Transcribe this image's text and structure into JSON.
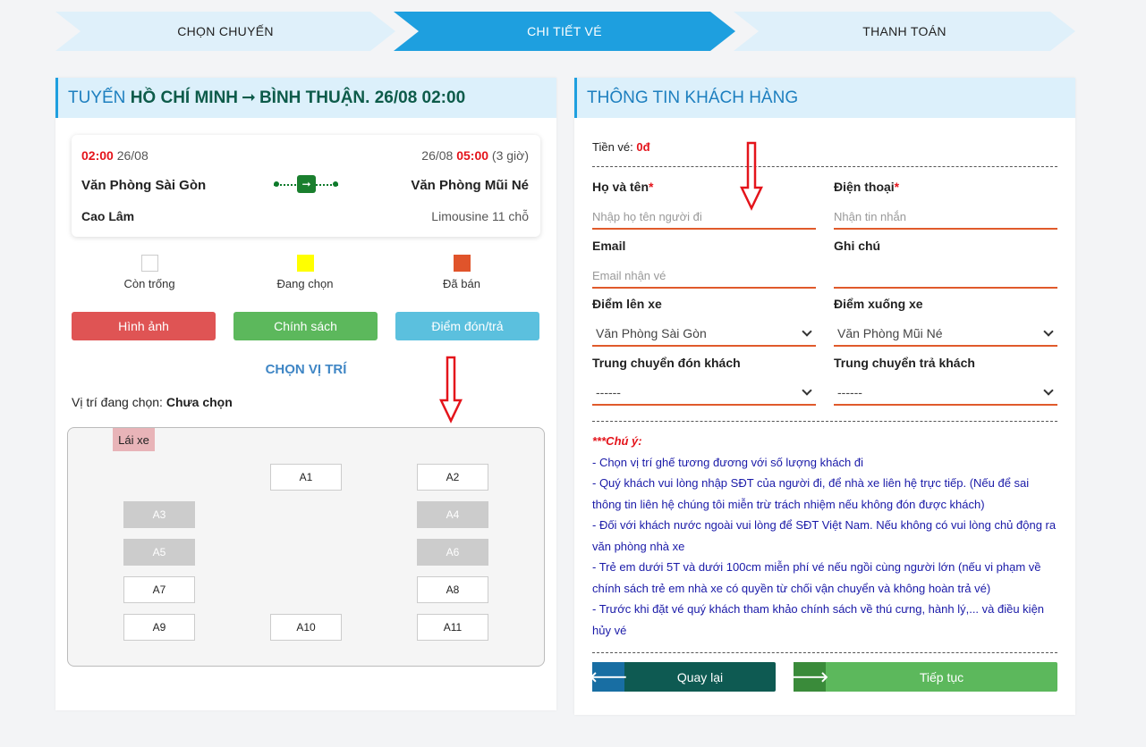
{
  "steps": [
    "CHỌN CHUYẾN",
    "CHI TIẾT VÉ",
    "THANH TOÁN"
  ],
  "route": {
    "prefix": "TUYẾN",
    "from": "HỒ CHÍ MINH",
    "arrow": "➞",
    "to": "BÌNH THUẬN",
    "datetime": ". 26/08 02:00"
  },
  "trip": {
    "depart_time": "02:00",
    "depart_date": "26/08",
    "arrive_date": "26/08",
    "arrive_time": "05:00",
    "duration": "(3 giờ)",
    "from_office": "Văn Phòng Sài Gòn",
    "to_office": "Văn Phòng Mũi Né",
    "operator": "Cao Lâm",
    "vehicle": "Limousine 11 chỗ"
  },
  "legend": [
    {
      "label": "Còn trống",
      "color": "#ffffff"
    },
    {
      "label": "Đang chọn",
      "color": "#ffff00"
    },
    {
      "label": "Đã bán",
      "color": "#e0542b"
    }
  ],
  "buttons": {
    "images": "Hình ảnh",
    "policy": "Chính sách",
    "points": "Điểm đón/trả"
  },
  "choose_title": "CHỌN VỊ TRÍ",
  "current_pos": {
    "label": "Vị trí đang chọn: ",
    "value": "Chưa chọn"
  },
  "driver": "Lái xe",
  "seats": [
    {
      "label": "A1",
      "sold": false
    },
    {
      "label": "A2",
      "sold": false
    },
    {
      "label": "A3",
      "sold": true
    },
    {
      "label": "A4",
      "sold": true
    },
    {
      "label": "A5",
      "sold": true
    },
    {
      "label": "A6",
      "sold": true
    },
    {
      "label": "A7",
      "sold": false
    },
    {
      "label": "A8",
      "sold": false
    },
    {
      "label": "A9",
      "sold": false
    },
    {
      "label": "A10",
      "sold": false
    },
    {
      "label": "A11",
      "sold": false
    }
  ],
  "customer": {
    "title": "THÔNG TIN KHÁCH HÀNG",
    "price_label": "Tiền vé: ",
    "price_value": "0đ",
    "name_label": "Họ và tên",
    "name_placeholder": "Nhập họ tên người đi",
    "phone_label": "Điện thoại",
    "phone_placeholder": "Nhận tin nhắn",
    "email_label": "Email",
    "email_placeholder": "Email nhận vé",
    "note_label": "Ghi chú",
    "note_placeholder": "",
    "pickup_label": "Điểm lên xe",
    "pickup_value": "Văn Phòng Sài Gòn",
    "dropoff_label": "Điểm xuống xe",
    "dropoff_value": "Văn Phòng Mũi Né",
    "transfer_pick_label": "Trung chuyển đón khách",
    "transfer_pick_value": "------",
    "transfer_drop_label": "Trung chuyển trả khách",
    "transfer_drop_value": "------",
    "required_mark": "*"
  },
  "notes": {
    "title": "***Chú ý:",
    "lines": [
      "- Chọn vị trí ghế tương đương với số lượng khách đi",
      "- Quý khách vui lòng nhập SĐT của người đi, để nhà xe liên hệ trực tiếp. (Nếu để sai thông tin liên hệ chúng tôi miễn trừ trách nhiệm nếu không đón được khách)",
      "- Đối với khách nước ngoài vui lòng để SĐT Việt Nam. Nếu không có vui lòng chủ động ra văn phòng nhà xe",
      "- Trẻ em dưới 5T và dưới 100cm miễn phí vé nếu ngồi cùng người lớn (nếu vi phạm về chính sách trẻ em nhà xe có quyền từ chối vận chuyển và không hoàn trả vé)",
      "- Trước khi đặt vé quý khách tham khảo chính sách về thú cưng, hành lý,... và điều kiện hủy vé"
    ]
  },
  "nav": {
    "back": "Quay lại",
    "next": "Tiếp tục"
  },
  "icons": {
    "back": "arrow-left-icon",
    "next": "arrow-right-icon",
    "bus": "bus-icon"
  },
  "colors": {
    "accent": "#1e9fdf",
    "danger": "#e4141b",
    "sold": "#e0542b",
    "selected": "#ffff00"
  }
}
